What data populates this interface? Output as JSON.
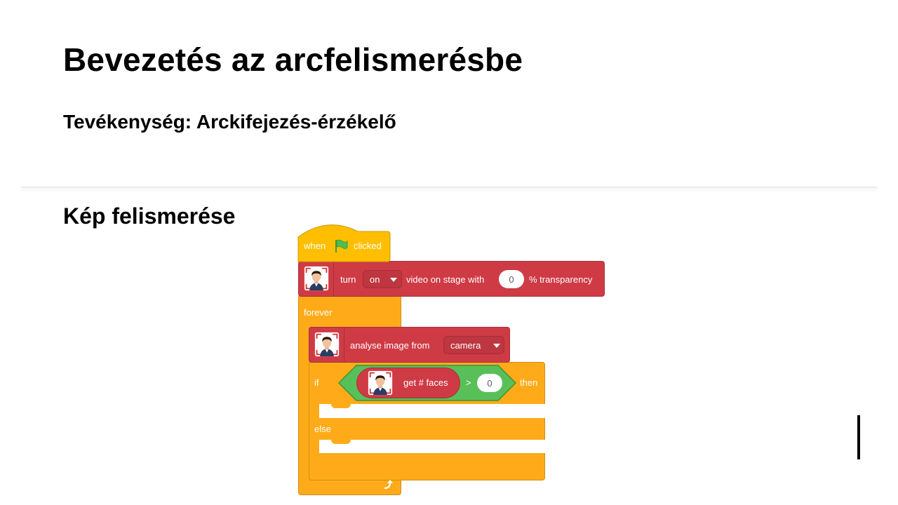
{
  "slide": {
    "title": "Bevezetés az arcfelismerésbe",
    "subtitle": "Tevékenység: Arckifejezés-érzékelő",
    "section_heading": "Kép felismerése"
  },
  "colors": {
    "event_orange": "#ffbf00",
    "control_orange": "#ffab19",
    "extension_red": "#cf3b45",
    "operator_green": "#59c059",
    "flag_green": "#4cbf56"
  },
  "blocks": {
    "hat": {
      "when": "when",
      "flag_icon": "green-flag-icon",
      "clicked": "clicked"
    },
    "video": {
      "turn": "turn",
      "state": "on",
      "middle": "video on stage with",
      "transparency": "0",
      "suffix": "% transparency"
    },
    "forever": {
      "label": "forever"
    },
    "analyse": {
      "label": "analyse image from",
      "source": "camera"
    },
    "if": {
      "if_label": "if",
      "reporter": "get # faces",
      "operator": ">",
      "value": "0",
      "then_label": "then",
      "else_label": "else"
    }
  }
}
